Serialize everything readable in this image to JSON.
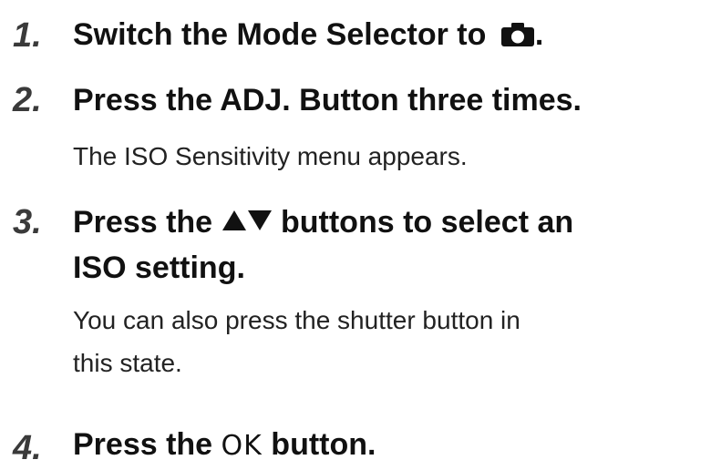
{
  "steps": [
    {
      "number": "1.",
      "title_before": "Switch the Mode Selector to",
      "title_after": ".",
      "icon": "camera-icon"
    },
    {
      "number": "2.",
      "title": "Press the ADJ. Button three times.",
      "description": "The ISO Sensitivity menu appears."
    },
    {
      "number": "3.",
      "title_before": "Press the",
      "title_after": "buttons to select an",
      "title_line2": "ISO setting.",
      "icons": [
        "up-triangle-icon",
        "down-triangle-icon"
      ],
      "description_line1": "You can also press the shutter button in",
      "description_line2": "this state."
    },
    {
      "number": "4.",
      "title_before": "Press the",
      "title_button": "OK",
      "title_after": "button."
    }
  ]
}
